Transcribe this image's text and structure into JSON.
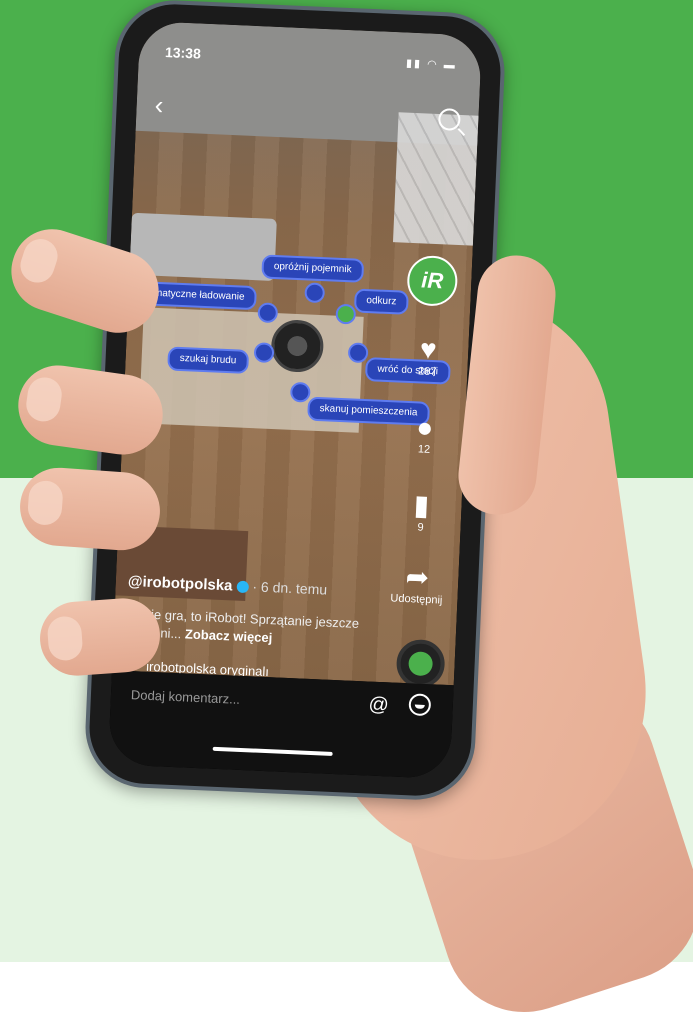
{
  "status": {
    "time": "13:38",
    "signal_icons": "signal-wifi-battery"
  },
  "video": {
    "labels": {
      "empty_bin": "opróżnij pojemnik",
      "auto_charge": "automatyczne ładowanie",
      "vacuum": "odkurz",
      "find_dirt": "szukaj brudu",
      "return_dock": "wróć do stacji",
      "scan_rooms": "skanuj pomieszczenia"
    }
  },
  "rail": {
    "avatar_letter": "iR",
    "likes": "287",
    "comments": "12",
    "saves": "9",
    "share_label": "Udostępnij"
  },
  "post": {
    "author": "@irobotpolska",
    "time_ago": "· 6 dn. temu",
    "caption_text": "To nie gra, to iRobot! Sprzątanie jeszcze nigdy ni...",
    "see_more": "Zobacz więcej",
    "music": "irobotpolska   oryginalı"
  },
  "bottom": {
    "comment_placeholder": "Dodaj komentarz..."
  },
  "colors": {
    "brand_green": "#4bb04c",
    "pill_blue": "#2a45b8"
  }
}
